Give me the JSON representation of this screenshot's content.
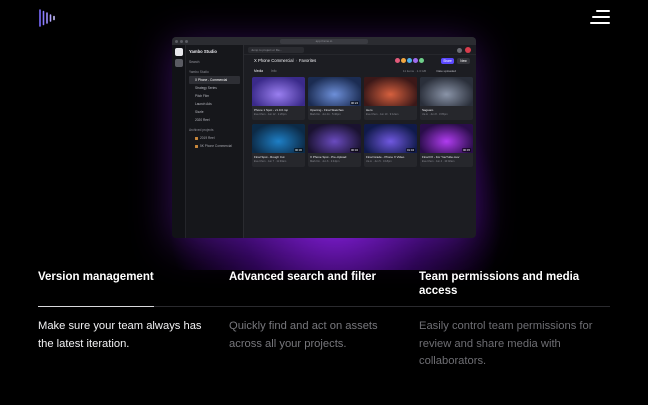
{
  "nav": {
    "logo_icon": "sound-wave-logo-icon",
    "menu_icon": "hamburger-menu-icon"
  },
  "colors": {
    "accent": "#5b49ff",
    "glow": "#8c1ee6",
    "background": "#000000"
  },
  "app": {
    "titlebar_url": "app.frame.io",
    "team_name": "Yambo Studio",
    "sidebar_search": "Search",
    "projects_label": "Yambo Studio",
    "projects": [
      "X Phone - Commercial",
      "Strategy Series",
      "Pitch Film",
      "Launch Ads",
      "Sizzle",
      "2020 Reel"
    ],
    "archived_label": "Archived projects",
    "archived_projects": [
      "2019 Reel",
      "5K Phone Commercial"
    ],
    "global_search_placeholder": "Jump to project or file...",
    "breadcrumb": {
      "project": "X Phone Commercial",
      "folder": "Favorites"
    },
    "share_label": "Share",
    "new_label": "New",
    "tabs": [
      "Media",
      "Info"
    ],
    "meta": "11 items · 1.3 GB",
    "sort_label": "Date uploaded",
    "assets": [
      {
        "title": "Phone 1 Spot - v1.0.0.mp",
        "meta": "Eva Chen · Jun 12 · 1:20pm",
        "duration": "",
        "colors": [
          "#3a2a8a",
          "#9a7ff0"
        ]
      },
      {
        "title": "Opening - Final Sketches",
        "meta": "Mark Do · Jun 11 · 5:40pm",
        "duration": "00:24",
        "colors": [
          "#1b2c52",
          "#6d8fd9"
        ]
      },
      {
        "title": "Hero",
        "meta": "Eva Chen · Jun 10 · 9:12am",
        "duration": "",
        "colors": [
          "#3b1818",
          "#d6603e"
        ]
      },
      {
        "title": "Saguaro",
        "meta": "Jia Li · Jun 8 · 3:05pm",
        "duration": "",
        "colors": [
          "#2a2f3a",
          "#8a94a8"
        ]
      },
      {
        "title": "Final Spot - Rough Cut",
        "meta": "Eva Chen · Jun 7 · 11:30am",
        "duration": "00:30",
        "colors": [
          "#0c2a46",
          "#1e7fc6"
        ]
      },
      {
        "title": "X Phone Spot - Pre-Upload",
        "meta": "Mark Do · Jun 6 · 2:44pm",
        "duration": "00:32",
        "colors": [
          "#1a1230",
          "#6a4bbf"
        ]
      },
      {
        "title": "Final Grade - Phone X Video",
        "meta": "Jia Li · Jun 5 · 4:18pm",
        "duration": "01:04",
        "colors": [
          "#101a4a",
          "#7058e0"
        ]
      },
      {
        "title": "Final FX - For YouTube.mov",
        "meta": "Eva Chen · Jun 4 · 10:02am",
        "duration": "00:45",
        "colors": [
          "#2a0d4a",
          "#b03cf0"
        ]
      }
    ]
  },
  "features": [
    {
      "title": "Version management",
      "desc": "Make sure your team always has the latest iteration.",
      "desc_color": "#f2f2f4"
    },
    {
      "title": "Advanced search and filter",
      "desc": "Quickly find and act on assets across all your projects.",
      "desc_color": "#77777c"
    },
    {
      "title": "Team permissions and media access",
      "desc": "Easily control team permissions for review and share media with collaborators.",
      "desc_color": "#6e6e73"
    }
  ]
}
